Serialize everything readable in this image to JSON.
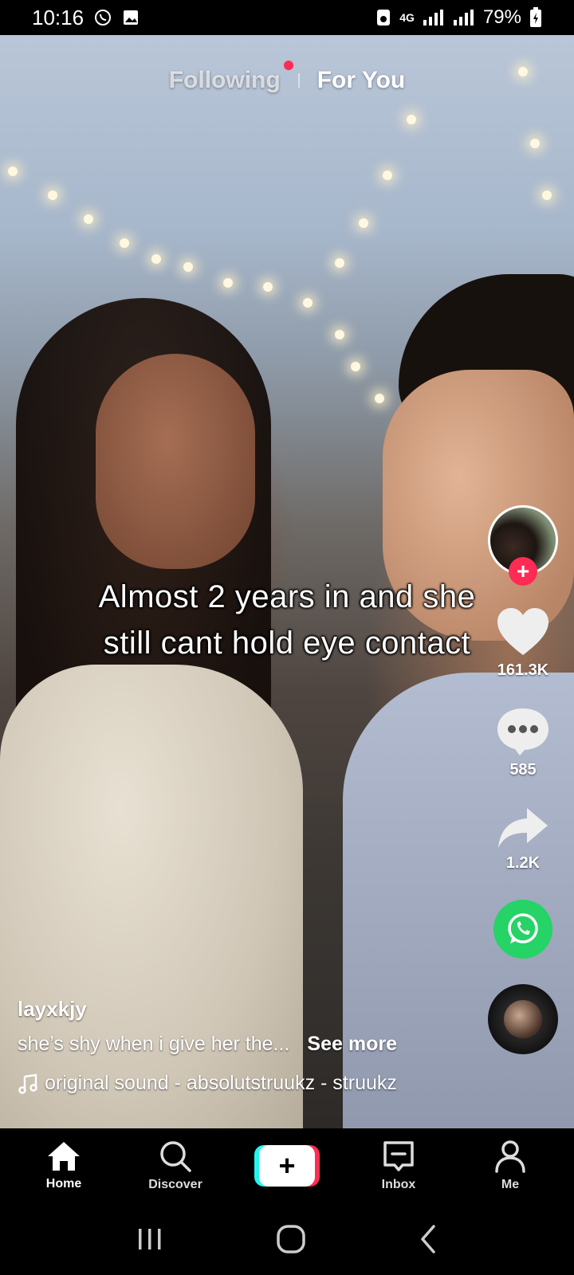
{
  "status_bar": {
    "time": "10:16",
    "network": "4G",
    "battery": "79%"
  },
  "top_tabs": {
    "following": "Following",
    "for_you": "For You"
  },
  "video": {
    "caption_line1": "Almost 2 years in and she",
    "caption_line2": "still cant hold eye contact"
  },
  "actions": {
    "likes": "161.3K",
    "comments": "585",
    "shares": "1.2K"
  },
  "post": {
    "username": "layxkjy",
    "description": "she’s shy when i give her the...",
    "see_more": "See more",
    "sound": "original sound - absolutstruukz - struukz"
  },
  "bottom_nav": {
    "home": "Home",
    "discover": "Discover",
    "create": "+",
    "inbox": "Inbox",
    "me": "Me"
  },
  "colors": {
    "accent_red": "#fe2c55",
    "accent_cyan": "#25f4ee",
    "whatsapp_green": "#25d366"
  }
}
